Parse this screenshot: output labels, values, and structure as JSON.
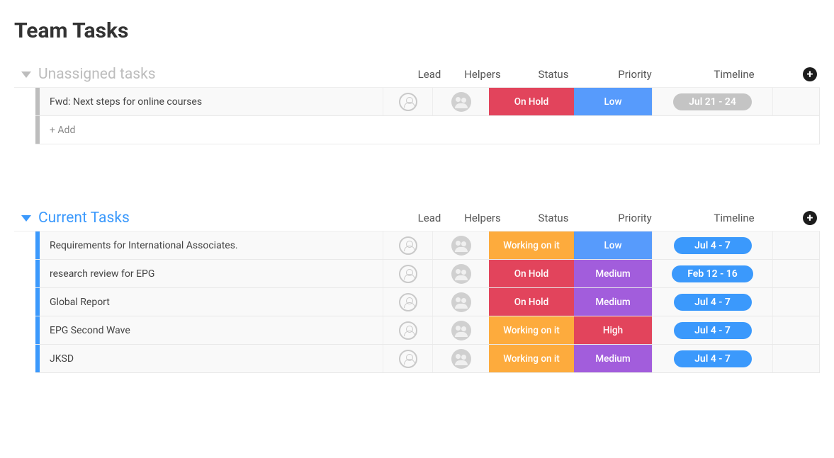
{
  "page_title": "Team Tasks",
  "columns": {
    "name": "",
    "lead": "Lead",
    "helpers": "Helpers",
    "status": "Status",
    "priority": "Priority",
    "timeline": "Timeline"
  },
  "status_colors": {
    "On Hold": "#e2445c",
    "Working on it": "#fdab3d"
  },
  "priority_colors": {
    "Low": "#579bfc",
    "Medium": "#a25ddc",
    "High": "#e2445c"
  },
  "timeline_colors": {
    "default": "#3b99fc",
    "muted": "#c4c4c4"
  },
  "groups": [
    {
      "id": "unassigned",
      "title": "Unassigned tasks",
      "accent": "grey",
      "add_label": "+ Add",
      "rows": [
        {
          "name": "Fwd: Next steps for online courses",
          "status": "On Hold",
          "priority": "Low",
          "timeline": "Jul 21 - 24",
          "timeline_style": "muted"
        }
      ]
    },
    {
      "id": "current",
      "title": "Current Tasks",
      "accent": "blue",
      "add_label": "",
      "rows": [
        {
          "name": "Requirements for International Associates.",
          "status": "Working on it",
          "priority": "Low",
          "timeline": "Jul 4 - 7",
          "timeline_style": "default"
        },
        {
          "name": "research review for EPG",
          "status": "On Hold",
          "priority": "Medium",
          "timeline": "Feb 12 - 16",
          "timeline_style": "default"
        },
        {
          "name": "Global Report",
          "status": "On Hold",
          "priority": "Medium",
          "timeline": "Jul 4 - 7",
          "timeline_style": "default"
        },
        {
          "name": "EPG Second Wave",
          "status": "Working on it",
          "priority": "High",
          "timeline": "Jul 4 - 7",
          "timeline_style": "default"
        },
        {
          "name": "JKSD",
          "status": "Working on it",
          "priority": "Medium",
          "timeline": "Jul 4 - 7",
          "timeline_style": "default"
        }
      ]
    }
  ]
}
